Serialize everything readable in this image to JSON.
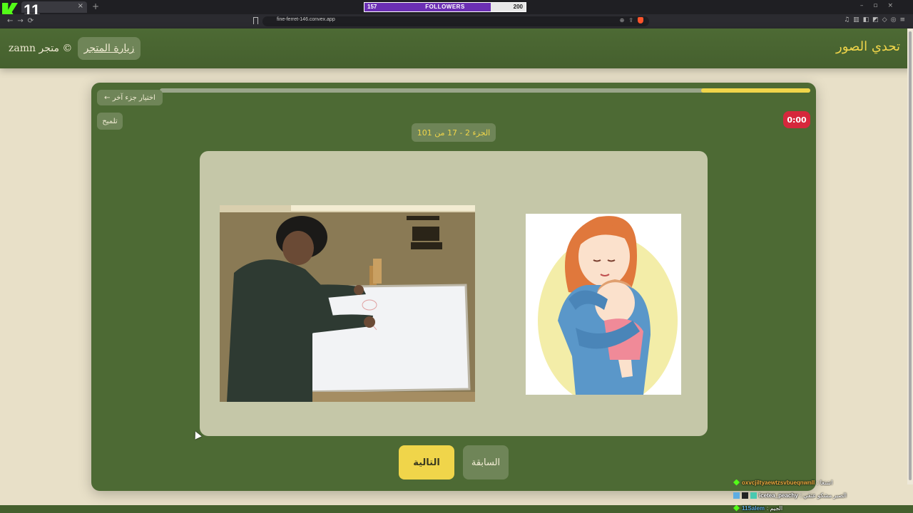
{
  "browser": {
    "tab_close": "×",
    "new_tab": "+",
    "window_controls": "–▫×",
    "nav_icons": "←→⟳",
    "url": "fine-ferret-146.convex.app",
    "url_icons": "⊕⇪",
    "ext_icons": "♫▥◧◩◇◎≡"
  },
  "stream_overlay": {
    "kick_count": "11",
    "followers": {
      "label": "FOLLOWERS",
      "current": "157",
      "goal": "200",
      "fraction": 0.785
    }
  },
  "header": {
    "title": "تحدي الصور",
    "store_button": "زيارة المتجر",
    "credit": "zamn متجر ©"
  },
  "game": {
    "back_button": "← اختيار جزء آخر",
    "hint_button": "تلميح",
    "part_label": "الجزء 2 - 17 من 101",
    "timer": "0:00",
    "progress_fraction": 0.168,
    "next_button": "التالية",
    "prev_button": "السابقة"
  },
  "chat": [
    {
      "user": "oxvcjiltyaewtzsvbueqnwnll",
      "user_color": "#f5b041",
      "text": ": اشتغا"
    },
    {
      "user": "icetea_peachy",
      "user_color": "#ffffff",
      "text": ": الصبر مشكو عتقي"
    },
    {
      "user": "11Salem",
      "user_color": "#5dade2",
      "text": ": الجيم"
    }
  ],
  "colors": {
    "header_green": "#4d6a34",
    "accent_yellow": "#f0d54a",
    "timer_red": "#d6283c",
    "page_beige": "#e8e0c8"
  }
}
